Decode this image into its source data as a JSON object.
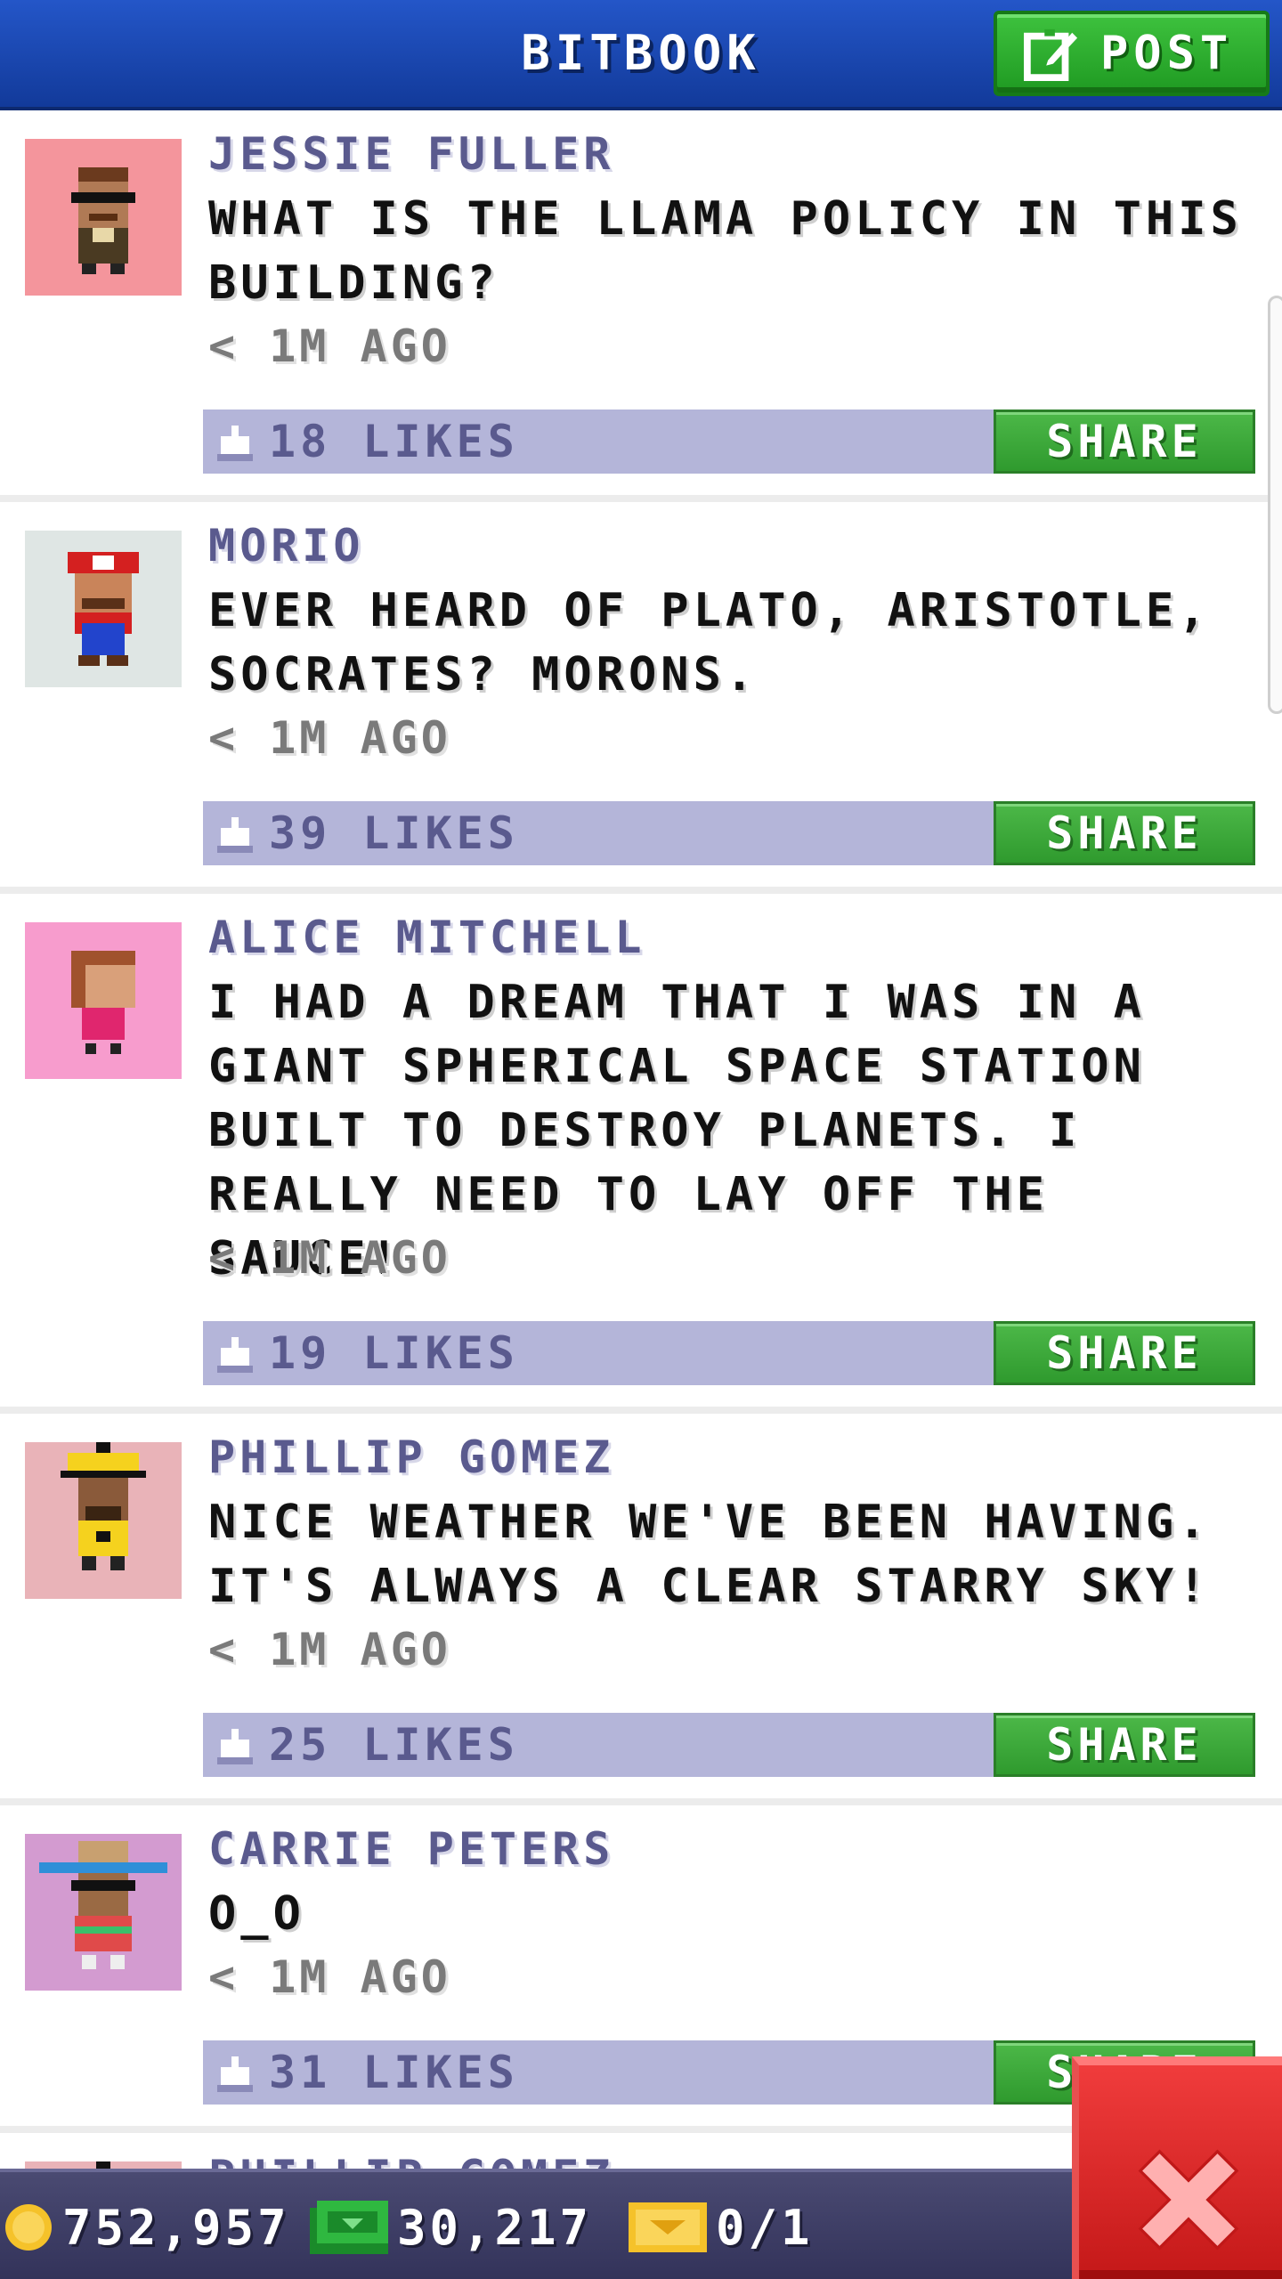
{
  "header": {
    "title": "BITBOOK",
    "post_label": "POST"
  },
  "posts": [
    {
      "author": "JESSIE FULLER",
      "message": "WHAT IS THE LLAMA POLICY IN THIS BUILDING?",
      "time": "< 1M AGO",
      "likes": "18 LIKES",
      "share": "SHARE",
      "avatar_bg": "#f4959c"
    },
    {
      "author": "MORIO",
      "message": "EVER HEARD OF PLATO, ARISTOTLE, SOCRATES? MORONS.",
      "time": "< 1M AGO",
      "likes": "39 LIKES",
      "share": "SHARE",
      "avatar_bg": "#dfe6e4"
    },
    {
      "author": "ALICE MITCHELL",
      "message": "I HAD A DREAM THAT I WAS IN A GIANT SPHERICAL SPACE STATION BUILT TO DESTROY PLANETS. I REALLY NEED TO LAY OFF THE SAUCE!",
      "time": "< 1M AGO",
      "likes": "19 LIKES",
      "share": "SHARE",
      "avatar_bg": "#f79ccd"
    },
    {
      "author": "PHILLIP GOMEZ",
      "message": "NICE WEATHER WE'VE BEEN HAVING. IT'S ALWAYS A CLEAR STARRY SKY!",
      "time": "< 1M AGO",
      "likes": "25 LIKES",
      "share": "SHARE",
      "avatar_bg": "#e9b3b8"
    },
    {
      "author": "CARRIE PETERS",
      "message": "O_O",
      "time": "< 1M AGO",
      "likes": "31 LIKES",
      "share": "SHARE",
      "avatar_bg": "#d39bd0"
    },
    {
      "author": "PHILLIP GOMEZ",
      "message": "",
      "time": "",
      "likes": "",
      "share": "",
      "avatar_bg": "#e9b3b8"
    }
  ],
  "status": {
    "coins": "752,957",
    "bux": "30,217",
    "tickets": "0/1"
  },
  "colors": {
    "header_blue": "#1d4cb8",
    "share_green": "#3aa838",
    "likes_bar": "#b4b5d9",
    "close_red": "#e02828"
  },
  "icons": [
    "compose-icon",
    "like-icon",
    "coin-icon",
    "bux-icon",
    "ticket-icon",
    "close-icon"
  ]
}
